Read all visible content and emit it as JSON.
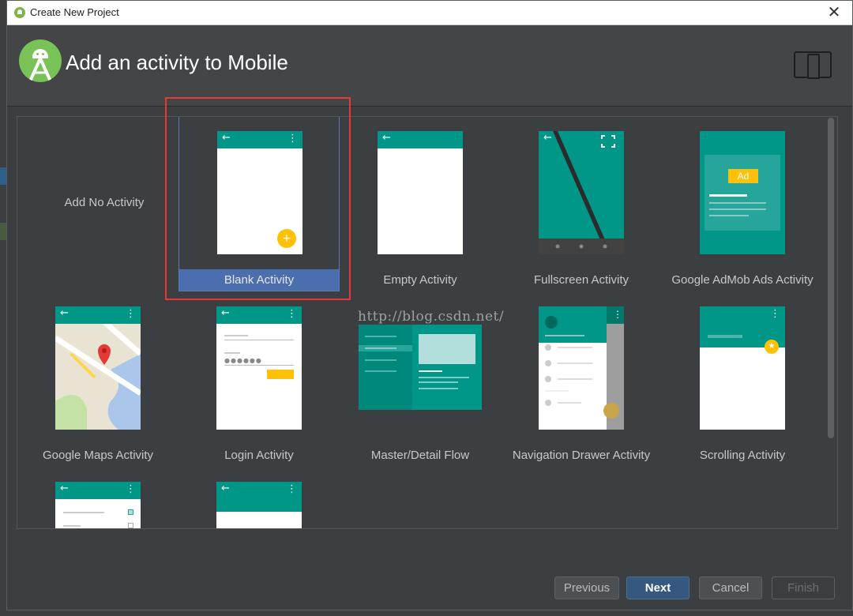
{
  "window": {
    "title": "Create New Project"
  },
  "header": {
    "title": "Add an activity to Mobile"
  },
  "items": [
    {
      "label": "Add No Activity"
    },
    {
      "label": "Blank Activity"
    },
    {
      "label": "Empty Activity"
    },
    {
      "label": "Fullscreen Activity"
    },
    {
      "label": "Google AdMob Ads Activity",
      "ad_badge": "Ad"
    },
    {
      "label": "Google Maps Activity"
    },
    {
      "label": "Login Activity"
    },
    {
      "label": "Master/Detail Flow"
    },
    {
      "label": "Navigation Drawer Activity"
    },
    {
      "label": "Scrolling Activity"
    }
  ],
  "selected_item": "Blank Activity",
  "watermark": "http://blog.csdn.net/",
  "buttons": {
    "previous": "Previous",
    "next": "Next",
    "cancel": "Cancel",
    "finish": "Finish"
  },
  "colors": {
    "accent": "#009688",
    "selection": "#4b6eaf",
    "fab": "#ffc107",
    "highlight_box": "#e53935"
  }
}
